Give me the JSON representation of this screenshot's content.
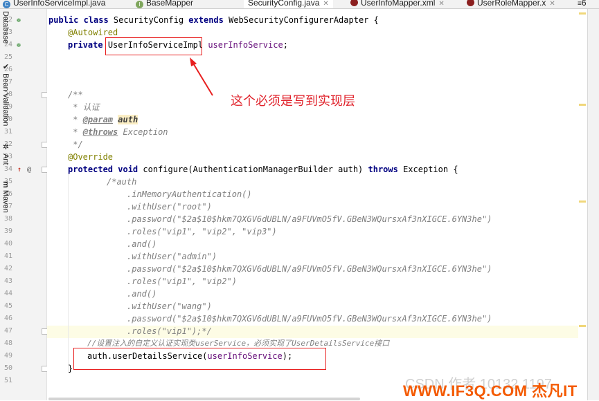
{
  "tabs": [
    {
      "label": "UserInfoServiceImpl.java",
      "icon": "class-icon",
      "color": "#3d82c4"
    },
    {
      "label": "BaseMapper",
      "icon": "interface-icon",
      "color": "#7fa65d"
    },
    {
      "label": "SecurityConfig.java",
      "icon": "class-icon",
      "color": "#3d82c4",
      "active": true
    },
    {
      "label": "UserInfoMapper.xml",
      "icon": "mybatis-icon",
      "color": "#8b1f1f"
    },
    {
      "label": "UserRoleMapper.x",
      "icon": "mybatis-icon",
      "color": "#8b1f1f"
    }
  ],
  "tab_overflow": "6",
  "line_numbers": [
    "22",
    "23",
    "24",
    "25",
    "26",
    "27",
    "28",
    "29",
    "30",
    "31",
    "32",
    "33",
    "34",
    "35",
    "36",
    "37",
    "38",
    "39",
    "40",
    "41",
    "42",
    "43",
    "44",
    "45",
    "46",
    "47",
    "48",
    "49",
    "50",
    "51"
  ],
  "code": {
    "l22": {
      "kw1": "public class",
      "name": " SecurityConfig ",
      "kw2": "extends",
      "rest": " WebSecurityConfigurerAdapter {"
    },
    "l23": {
      "ann": "@Autowired"
    },
    "l24": {
      "kw": "private",
      "type": "UserInfoServiceImpl",
      "field": "userInfoService",
      "end": ";"
    },
    "l28": "/**",
    "l29": " * 认证",
    "l30": {
      "pre": " * ",
      "tag": "@param",
      "param": "auth"
    },
    "l31": {
      "pre": " * ",
      "tag": "@throws",
      "exc": " Exception"
    },
    "l32": " */",
    "l33": "@Override",
    "l34": {
      "kw1": "protected void",
      "mid": " configure(AuthenticationManagerBuilder auth) ",
      "kw2": "throws",
      "end": " Exception {"
    },
    "l35": "/*auth",
    "l36": ".inMemoryAuthentication()",
    "l37": ".withUser(\"root\")",
    "l38": ".password(\"$2a$10$hkm7QXGV6dUBLN/a9FUVmO5fV.GBeN3WQursxAf3nXIGCE.6YN3he\")",
    "l39": ".roles(\"vip1\", \"vip2\", \"vip3\")",
    "l40": ".and()",
    "l41": ".withUser(\"admin\")",
    "l42": ".password(\"$2a$10$hkm7QXGV6dUBLN/a9FUVmO5fV.GBeN3WQursxAf3nXIGCE.6YN3he\")",
    "l43": ".roles(\"vip1\", \"vip2\")",
    "l44": ".and()",
    "l45": ".withUser(\"wang\")",
    "l46": ".password(\"$2a$10$hkm7QXGV6dUBLN/a9FUVmO5fV.GBeN3WQursxAf3nXIGCE.6YN3he\")",
    "l47": ".roles(\"vip1\");*/",
    "l48": "//设置注入的自定义认证实现类userService，必须实现了UserDetailsService接口",
    "l49": {
      "pre": "auth.userDetailsService(",
      "field": "userInfoService",
      "end": ");"
    },
    "l50": "}"
  },
  "annotation_note": "这个必须是写到实现层",
  "right_tools": [
    "Database",
    "Bean Validation",
    "Ant",
    "Maven"
  ],
  "watermark_text": "WWW.IF3Q.COM 杰凡IT",
  "watermark_faded": "CSDN 作者 10132 1197"
}
